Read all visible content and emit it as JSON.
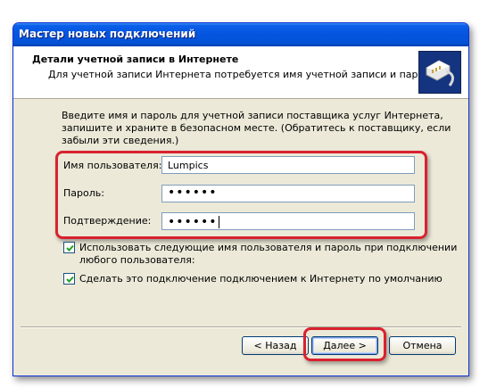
{
  "window": {
    "title": "Мастер новых подключений"
  },
  "header": {
    "title": "Детали учетной записи в Интернете",
    "subtitle": "Для учетной записи Интернета потребуется имя учетной записи и пароль.",
    "icon": "phone-connector-icon"
  },
  "instructions": "Введите имя и пароль для учетной записи поставщика услуг Интернета, запишите и храните в безопасном месте. (Обратитесь к поставщику, если забыли эти сведения.)",
  "form": {
    "username_label": "Имя пользователя:",
    "username_value": "Lumpics",
    "password_label": "Пароль:",
    "password_value": "••••••",
    "confirm_label": "Подтверждение:",
    "confirm_value": "••••••"
  },
  "options": {
    "use_for_all_line1": "Использовать следующие имя пользователя и пароль при подключении",
    "use_for_all_line2": "любого пользователя:",
    "use_for_all_checked": true,
    "make_default": "Сделать это подключение подключением к Интернету по умолчанию",
    "make_default_checked": true
  },
  "buttons": {
    "back": "< Назад",
    "next": "Далее >",
    "cancel": "Отмена"
  },
  "colors": {
    "highlight": "#d8222f",
    "titlebar": "#0554df",
    "dialog_bg": "#ece9d8"
  }
}
